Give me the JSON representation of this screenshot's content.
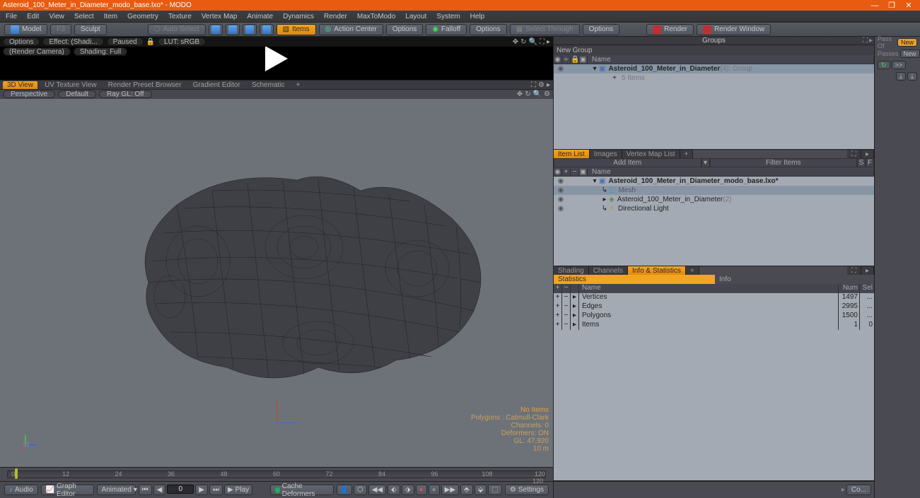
{
  "title": "Asteroid_100_Meter_in_Diameter_modo_base.lxo* - MODO",
  "menu": [
    "File",
    "Edit",
    "View",
    "Select",
    "Item",
    "Geometry",
    "Texture",
    "Vertex Map",
    "Animate",
    "Dynamics",
    "Render",
    "MaxToModo",
    "Layout",
    "System",
    "Help"
  ],
  "toolbar": {
    "model": "Model",
    "f3": "F3",
    "sculpt": "Sculpt",
    "auto": "Auto Select",
    "items": "Items",
    "action": "Action Center",
    "options": "Options",
    "falloff": "Falloff",
    "select_through": "Select Through",
    "render": "Render",
    "render_window": "Render Window"
  },
  "preview": {
    "options": "Options",
    "effect": "Effect: (Shadi...",
    "paused": "Paused",
    "lut": "LUT: sRGB",
    "camera": "(Render Camera)",
    "shading": "Shading: Full"
  },
  "tabs": {
    "v3d": "3D View",
    "uv": "UV Texture View",
    "preset": "Render Preset Browser",
    "grad": "Gradient Editor",
    "schem": "Schematic"
  },
  "vpbar": {
    "persp": "Perspective",
    "def": "Default",
    "ray": "Ray GL: Off"
  },
  "overlay": {
    "noitems": "No Items",
    "poly": "Polygons : Catmull-Clark",
    "chan": "Channels: 0",
    "def": "Deformers: ON",
    "gl": "GL: 47,920",
    "scale": "10 m"
  },
  "timeline": {
    "ticks": [
      "0",
      "12",
      "24",
      "36",
      "48",
      "60",
      "72",
      "84",
      "96",
      "108",
      "120"
    ],
    "end": "120"
  },
  "bottom": {
    "audio": "Audio",
    "graph": "Graph Editor",
    "mode": "Animated",
    "frame": "0",
    "play": "Play",
    "cache": "Cache Deformers",
    "settings": "Settings"
  },
  "groups": {
    "title": "Groups",
    "newgroup": "New Group",
    "name": "Name",
    "item": "Asteroid_100_Meter_in_Diameter",
    "count": "(4)",
    "type": ": Group",
    "sub": "5 Items"
  },
  "narrow": {
    "pass": "Pass Of",
    "new": "New",
    "passes": "Passes",
    "refresh": "↻",
    "fwd": ">>",
    "down1": "⤓",
    "down2": "⤓"
  },
  "itemlist": {
    "tabs": [
      "Item List",
      "Images",
      "Vertex Map List"
    ],
    "add": "Add Item",
    "filter": "Filter Items",
    "name": "Name",
    "scene": "Asteroid_100_Meter_in_Diameter_modo_base.lxo*",
    "mesh": "Mesh",
    "item": "Asteroid_100_Meter_in_Diameter",
    "itemcount": "(2)",
    "light": "Directional Light"
  },
  "info": {
    "tabs": [
      "Shading",
      "Channels",
      "Info & Statistics"
    ],
    "stats": "Statistics",
    "info": "Info",
    "name": "Name",
    "num": "Num",
    "sel": "Sel",
    "rows": [
      {
        "name": "Vertices",
        "num": "1497",
        "sel": "..."
      },
      {
        "name": "Edges",
        "num": "2995",
        "sel": "..."
      },
      {
        "name": "Polygons",
        "num": "1500",
        "sel": "..."
      },
      {
        "name": "Items",
        "num": "1",
        "sel": "0"
      }
    ]
  },
  "bottomright": {
    "co": "Co..."
  }
}
